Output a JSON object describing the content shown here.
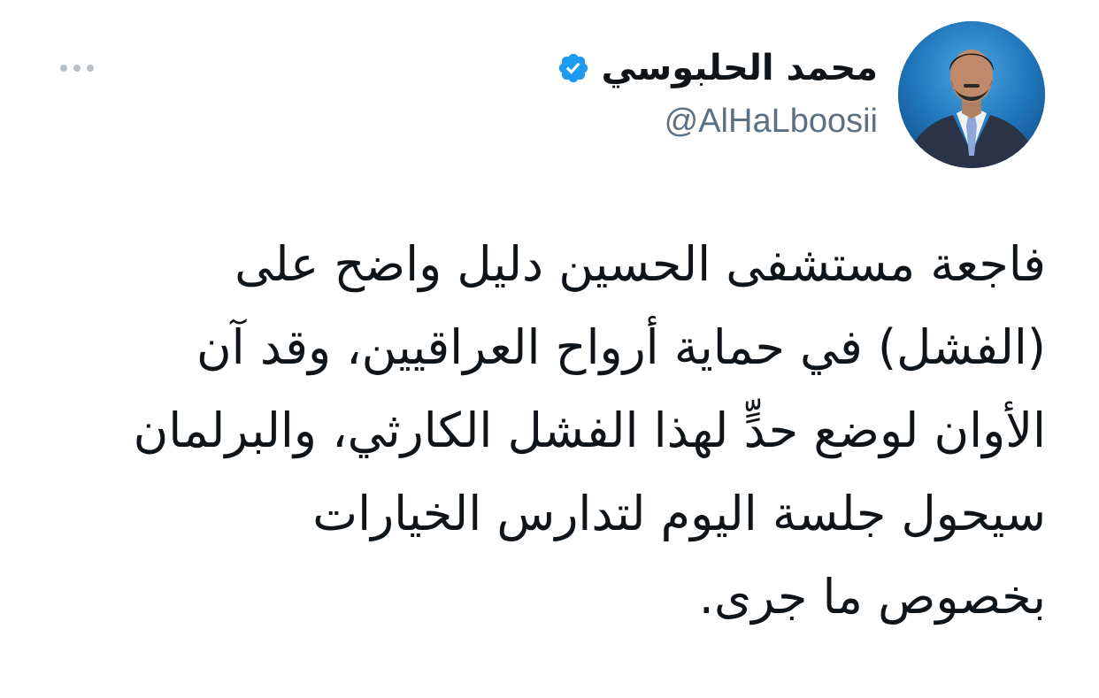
{
  "author": {
    "display_name": "محمد الحلبوسي",
    "handle": "@AlHaLboosii",
    "verified": true
  },
  "icons": {
    "more": "more-horizontal-icon",
    "verified": "verified-badge-icon",
    "avatar": "profile-photo"
  },
  "colors": {
    "verified_badge": "#1d9bf0",
    "handle": "#5b7083",
    "text": "#0f1419",
    "more_dots": "#b9c0c6"
  },
  "tweet": {
    "lines": [
      "فاجعة مستشفى الحسين دليل واضح على",
      "(الفشل) في حماية أرواح العراقيين، وقد آن",
      "الأوان لوضع حدٍّ لهذا الفشل الكارثي، والبرلمان",
      "سيحول جلسة اليوم لتدارس الخيارات",
      "بخصوص ما جرى."
    ]
  }
}
